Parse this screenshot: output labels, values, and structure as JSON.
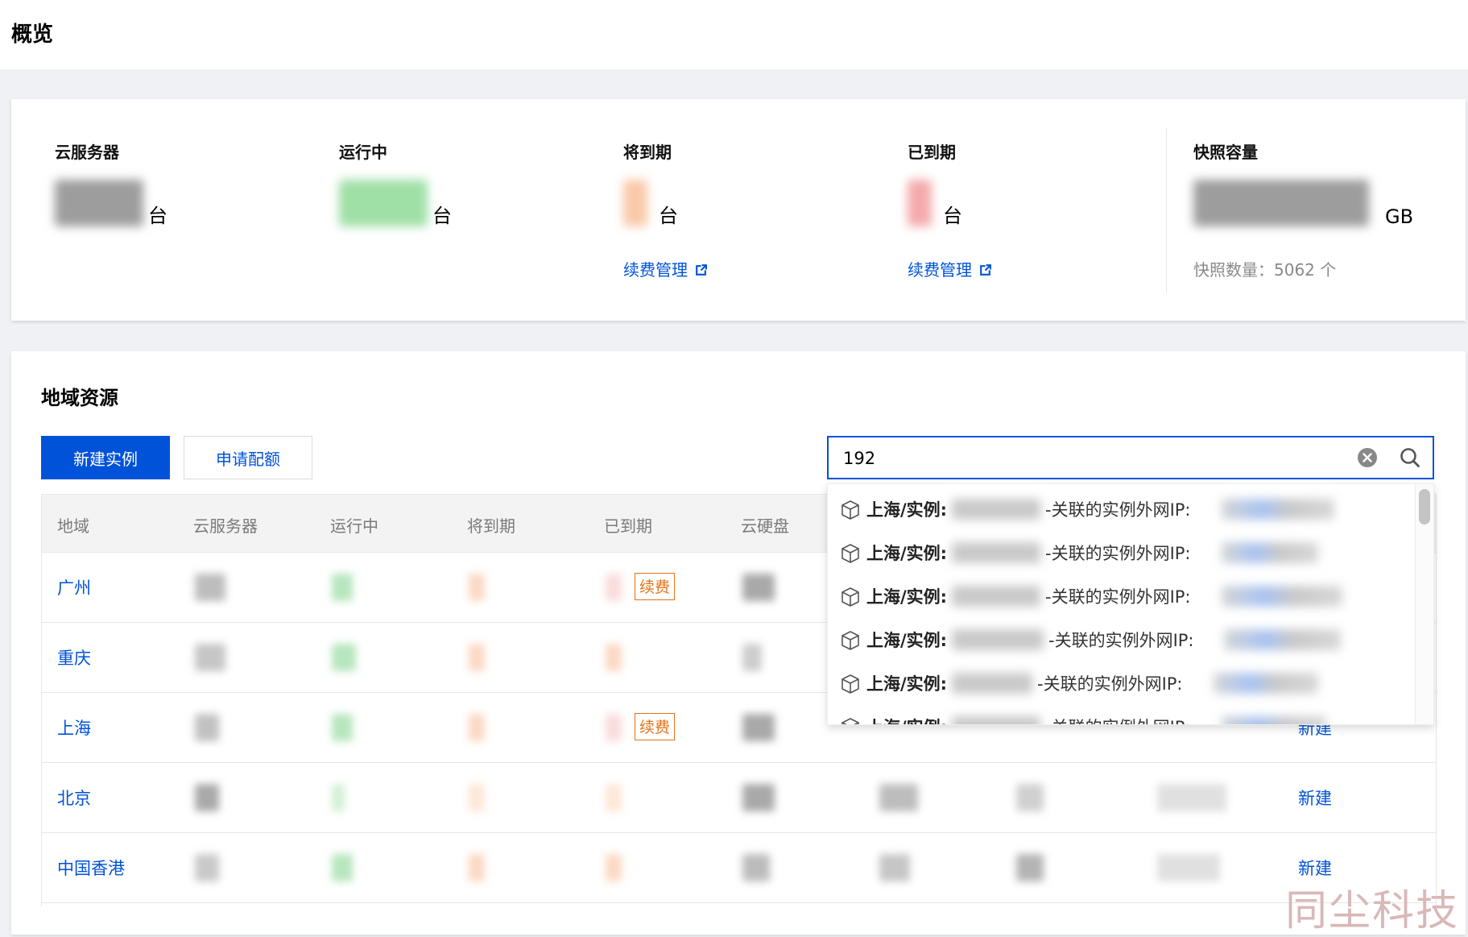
{
  "page": {
    "title": "概览"
  },
  "overview": {
    "items": [
      {
        "label": "云服务器",
        "unit": "台",
        "blur_color": "#9d9d9d"
      },
      {
        "label": "运行中",
        "unit": "台",
        "blur_color": "#9fe0a6"
      },
      {
        "label": "将到期",
        "unit": "台",
        "blur_color": "#f9c9a8",
        "link": "续费管理"
      },
      {
        "label": "已到期",
        "unit": "台",
        "blur_color": "#f4aaaa",
        "link": "续费管理"
      },
      {
        "label": "快照容量",
        "unit": "GB",
        "blur_color": "#9d9d9d",
        "sub": "快照数量：5062 个"
      }
    ]
  },
  "region": {
    "title": "地域资源",
    "new_instance": "新建实例",
    "apply_quota": "申请配额",
    "search": {
      "value": "192",
      "placeholder": ""
    },
    "columns": [
      "地域",
      "云服务器",
      "运行中",
      "将到期",
      "已到期",
      "云硬盘"
    ],
    "rows": [
      {
        "region": "广州",
        "renew": "续费",
        "action": ""
      },
      {
        "region": "重庆",
        "renew": "",
        "action": ""
      },
      {
        "region": "上海",
        "renew": "续费",
        "action": "新建"
      },
      {
        "region": "北京",
        "renew": "",
        "action": "新建"
      },
      {
        "region": "中国香港",
        "renew": "",
        "action": "新建"
      }
    ]
  },
  "dropdown": {
    "items": [
      {
        "prefix": "上海/实例:",
        "mid": "-关联的实例外网IP:"
      },
      {
        "prefix": "上海/实例:",
        "mid": "-关联的实例外网IP:"
      },
      {
        "prefix": "上海/实例:",
        "mid": "-关联的实例外网IP:"
      },
      {
        "prefix": "上海/实例:",
        "mid": "-关联的实例外网IP:"
      },
      {
        "prefix": "上海/实例:",
        "mid": "-关联的实例外网IP:"
      },
      {
        "prefix": "上海/实例:",
        "mid": "-关联的实例外网IP:"
      }
    ]
  },
  "watermark": "同尘科技",
  "colors": {
    "accent": "#0052d9",
    "warning": "#e37318"
  }
}
